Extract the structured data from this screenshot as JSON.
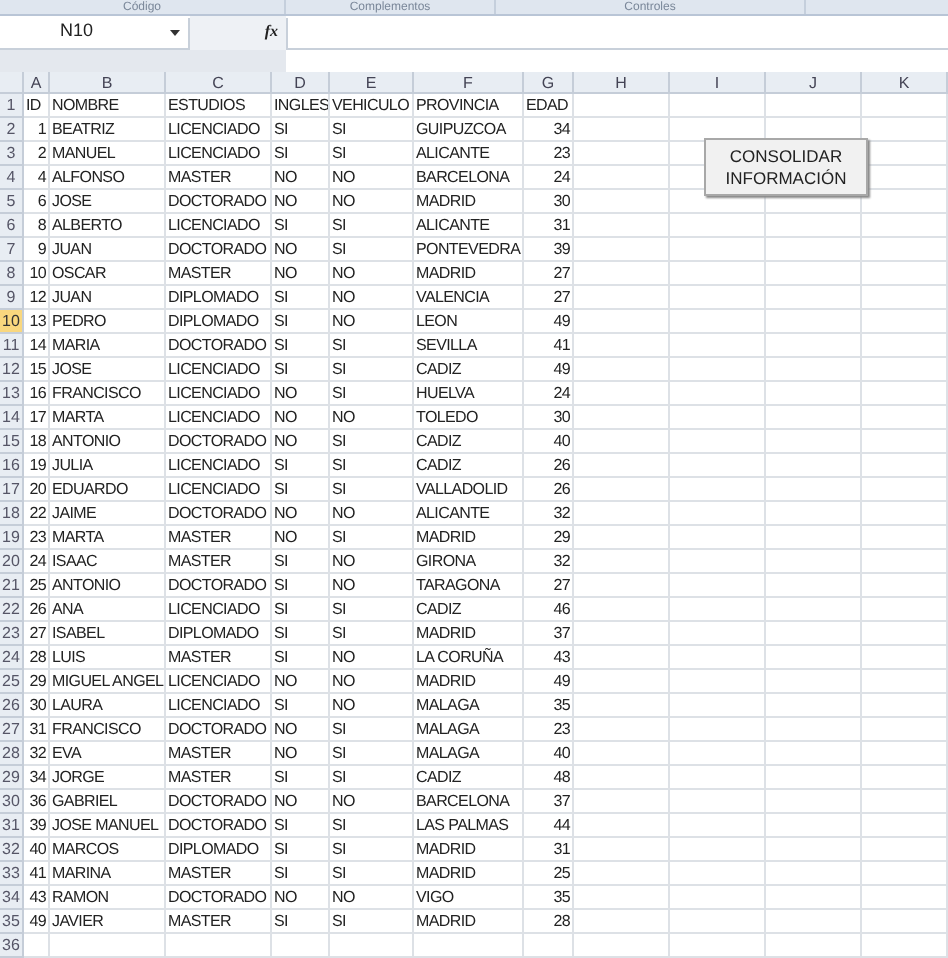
{
  "ribbon_groups": [
    "Código",
    "Complementos",
    "Controles"
  ],
  "name_box": "N10",
  "function_button": "fx",
  "column_headers": [
    "A",
    "B",
    "C",
    "D",
    "E",
    "F",
    "G",
    "H",
    "I",
    "J",
    "K"
  ],
  "rows": [
    {
      "number": "1",
      "selected": false,
      "cells": [
        "ID",
        "NOMBRE",
        "ESTUDIOS",
        "INGLES",
        "VEHICULO",
        "PROVINCIA",
        "EDAD"
      ]
    },
    {
      "number": "2",
      "selected": false,
      "cells": [
        "1",
        "BEATRIZ",
        "LICENCIADO",
        "SI",
        "SI",
        "GUIPUZCOA",
        "34"
      ]
    },
    {
      "number": "3",
      "selected": false,
      "cells": [
        "2",
        "MANUEL",
        "LICENCIADO",
        "SI",
        "SI",
        "ALICANTE",
        "23"
      ]
    },
    {
      "number": "4",
      "selected": false,
      "cells": [
        "4",
        "ALFONSO",
        "MASTER",
        "NO",
        "NO",
        "BARCELONA",
        "24"
      ]
    },
    {
      "number": "5",
      "selected": false,
      "cells": [
        "6",
        "JOSE",
        "DOCTORADO",
        "NO",
        "NO",
        "MADRID",
        "30"
      ]
    },
    {
      "number": "6",
      "selected": false,
      "cells": [
        "8",
        "ALBERTO",
        "LICENCIADO",
        "SI",
        "SI",
        "ALICANTE",
        "31"
      ]
    },
    {
      "number": "7",
      "selected": false,
      "cells": [
        "9",
        "JUAN",
        "DOCTORADO",
        "NO",
        "SI",
        "PONTEVEDRA",
        "39"
      ]
    },
    {
      "number": "8",
      "selected": false,
      "cells": [
        "10",
        "OSCAR",
        "MASTER",
        "NO",
        "NO",
        "MADRID",
        "27"
      ]
    },
    {
      "number": "9",
      "selected": false,
      "cells": [
        "12",
        "JUAN",
        "DIPLOMADO",
        "SI",
        "NO",
        "VALENCIA",
        "27"
      ]
    },
    {
      "number": "10",
      "selected": true,
      "cells": [
        "13",
        "PEDRO",
        "DIPLOMADO",
        "SI",
        "NO",
        "LEON",
        "49"
      ]
    },
    {
      "number": "11",
      "selected": false,
      "cells": [
        "14",
        "MARIA",
        "DOCTORADO",
        "SI",
        "SI",
        "SEVILLA",
        "41"
      ]
    },
    {
      "number": "12",
      "selected": false,
      "cells": [
        "15",
        "JOSE",
        "LICENCIADO",
        "SI",
        "SI",
        "CADIZ",
        "49"
      ]
    },
    {
      "number": "13",
      "selected": false,
      "cells": [
        "16",
        "FRANCISCO",
        "LICENCIADO",
        "NO",
        "SI",
        "HUELVA",
        "24"
      ]
    },
    {
      "number": "14",
      "selected": false,
      "cells": [
        "17",
        "MARTA",
        "LICENCIADO",
        "NO",
        "NO",
        "TOLEDO",
        "30"
      ]
    },
    {
      "number": "15",
      "selected": false,
      "cells": [
        "18",
        "ANTONIO",
        "DOCTORADO",
        "NO",
        "SI",
        "CADIZ",
        "40"
      ]
    },
    {
      "number": "16",
      "selected": false,
      "cells": [
        "19",
        "JULIA",
        "LICENCIADO",
        "SI",
        "SI",
        "CADIZ",
        "26"
      ]
    },
    {
      "number": "17",
      "selected": false,
      "cells": [
        "20",
        "EDUARDO",
        "LICENCIADO",
        "SI",
        "SI",
        "VALLADOLID",
        "26"
      ]
    },
    {
      "number": "18",
      "selected": false,
      "cells": [
        "22",
        "JAIME",
        "DOCTORADO",
        "NO",
        "NO",
        "ALICANTE",
        "32"
      ]
    },
    {
      "number": "19",
      "selected": false,
      "cells": [
        "23",
        "MARTA",
        "MASTER",
        "NO",
        "SI",
        "MADRID",
        "29"
      ]
    },
    {
      "number": "20",
      "selected": false,
      "cells": [
        "24",
        "ISAAC",
        "MASTER",
        "SI",
        "NO",
        "GIRONA",
        "32"
      ]
    },
    {
      "number": "21",
      "selected": false,
      "cells": [
        "25",
        "ANTONIO",
        "DOCTORADO",
        "SI",
        "NO",
        "TARAGONA",
        "27"
      ]
    },
    {
      "number": "22",
      "selected": false,
      "cells": [
        "26",
        "ANA",
        "LICENCIADO",
        "SI",
        "SI",
        "CADIZ",
        "46"
      ]
    },
    {
      "number": "23",
      "selected": false,
      "cells": [
        "27",
        "ISABEL",
        "DIPLOMADO",
        "SI",
        "SI",
        "MADRID",
        "37"
      ]
    },
    {
      "number": "24",
      "selected": false,
      "cells": [
        "28",
        "LUIS",
        "MASTER",
        "SI",
        "NO",
        "LA CORUÑA",
        "43"
      ]
    },
    {
      "number": "25",
      "selected": false,
      "cells": [
        "29",
        "MIGUEL ANGEL",
        "LICENCIADO",
        "NO",
        "NO",
        "MADRID",
        "49"
      ]
    },
    {
      "number": "26",
      "selected": false,
      "cells": [
        "30",
        "LAURA",
        "LICENCIADO",
        "SI",
        "NO",
        "MALAGA",
        "35"
      ]
    },
    {
      "number": "27",
      "selected": false,
      "cells": [
        "31",
        "FRANCISCO",
        "DOCTORADO",
        "NO",
        "SI",
        "MALAGA",
        "23"
      ]
    },
    {
      "number": "28",
      "selected": false,
      "cells": [
        "32",
        "EVA",
        "MASTER",
        "NO",
        "SI",
        "MALAGA",
        "40"
      ]
    },
    {
      "number": "29",
      "selected": false,
      "cells": [
        "34",
        "JORGE",
        "MASTER",
        "SI",
        "SI",
        "CADIZ",
        "48"
      ]
    },
    {
      "number": "30",
      "selected": false,
      "cells": [
        "36",
        "GABRIEL",
        "DOCTORADO",
        "NO",
        "NO",
        "BARCELONA",
        "37"
      ]
    },
    {
      "number": "31",
      "selected": false,
      "cells": [
        "39",
        "JOSE MANUEL",
        "DOCTORADO",
        "SI",
        "SI",
        "LAS PALMAS",
        "44"
      ]
    },
    {
      "number": "32",
      "selected": false,
      "cells": [
        "40",
        "MARCOS",
        "DIPLOMADO",
        "SI",
        "SI",
        "MADRID",
        "31"
      ]
    },
    {
      "number": "33",
      "selected": false,
      "cells": [
        "41",
        "MARINA",
        "MASTER",
        "SI",
        "SI",
        "MADRID",
        "25"
      ]
    },
    {
      "number": "34",
      "selected": false,
      "cells": [
        "43",
        "RAMON",
        "DOCTORADO",
        "NO",
        "NO",
        "VIGO",
        "35"
      ]
    },
    {
      "number": "35",
      "selected": false,
      "cells": [
        "49",
        "JAVIER",
        "MASTER",
        "SI",
        "SI",
        "MADRID",
        "28"
      ]
    },
    {
      "number": "36",
      "selected": false
    }
  ],
  "button": "CONSOLIDAR INFORMACIÓN"
}
